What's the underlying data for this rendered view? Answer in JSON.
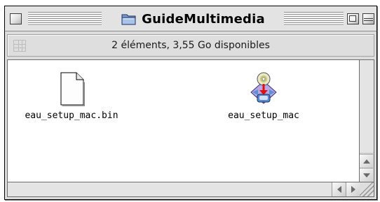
{
  "window": {
    "title": "GuideMultimedia",
    "status": "2 éléments, 3,55 Go disponibles"
  },
  "files": [
    {
      "name": "eau_setup_mac.bin",
      "icon": "document-icon"
    },
    {
      "name": "eau_setup_mac",
      "icon": "installer-app-icon"
    }
  ],
  "colors": {
    "window_bg": "#dcdcdc",
    "content_bg": "#ffffff",
    "folder_blue": "#6f8fc0"
  }
}
